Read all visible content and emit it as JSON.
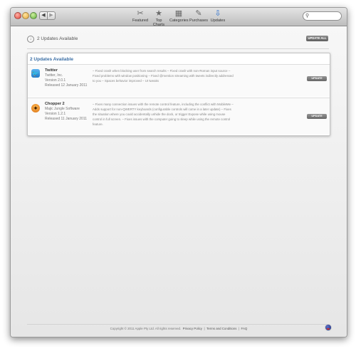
{
  "toolbar": {
    "tabs": [
      {
        "label": "Featured",
        "icon": "featured-icon",
        "glyph": "✂"
      },
      {
        "label": "Top Charts",
        "icon": "star-icon",
        "glyph": "★"
      },
      {
        "label": "Categories",
        "icon": "categories-icon",
        "glyph": "▦"
      },
      {
        "label": "Purchases",
        "icon": "purchases-icon",
        "glyph": "✎"
      },
      {
        "label": "Updates",
        "icon": "updates-icon",
        "glyph": "⇩"
      }
    ],
    "active_tab": "Updates",
    "search": {
      "placeholder": "",
      "icon": "search-icon"
    }
  },
  "header": {
    "updates_available": "2 Updates Available",
    "update_all_label": "UPDATE ALL"
  },
  "panel": {
    "title": "2 Updates Available",
    "apps": [
      {
        "name": "Twitter",
        "developer": "Twitter, Inc.",
        "version": "Version 2.0.1",
        "released": "Released 12 January 2011",
        "notes": "– Fixed crash when blocking user from search results – Fixed crash with non-Roman input source – Fixed problems with window positioning – Fixed @mention streaming with tweets indirectly addressed to you – Spaces behavior improved – UI tweaks",
        "button_label": "UPDATE",
        "icon": "twitter-bird-icon"
      },
      {
        "name": "Chopper 2",
        "developer": "Majic Jungle Software",
        "version": "Version 1.2.1",
        "released": "Released 11 January 2011",
        "notes": "– Fixes many connection issues with the remote control feature, including the conflict with MobileMe – Adds support for non-QWERTY keyboards (configurable controls will come in a later update) – Fixes the situation where you could accidentally unhide the dock, or trigger Expose while using mouse control in full screen. – Fixes issues with the computer going to sleep while using the remote control feature.",
        "button_label": "UPDATE",
        "icon": "chopper-icon"
      }
    ]
  },
  "footer": {
    "copyright": "Copyright © 2011 Apple Pty Ltd. All rights reserved.",
    "privacy": "Privacy Policy",
    "sep": "|",
    "terms": "Terms and Conditions",
    "faq": "FAQ"
  },
  "colors": {
    "accent": "#3a6ea5",
    "active_tab": "#2b6fce"
  }
}
